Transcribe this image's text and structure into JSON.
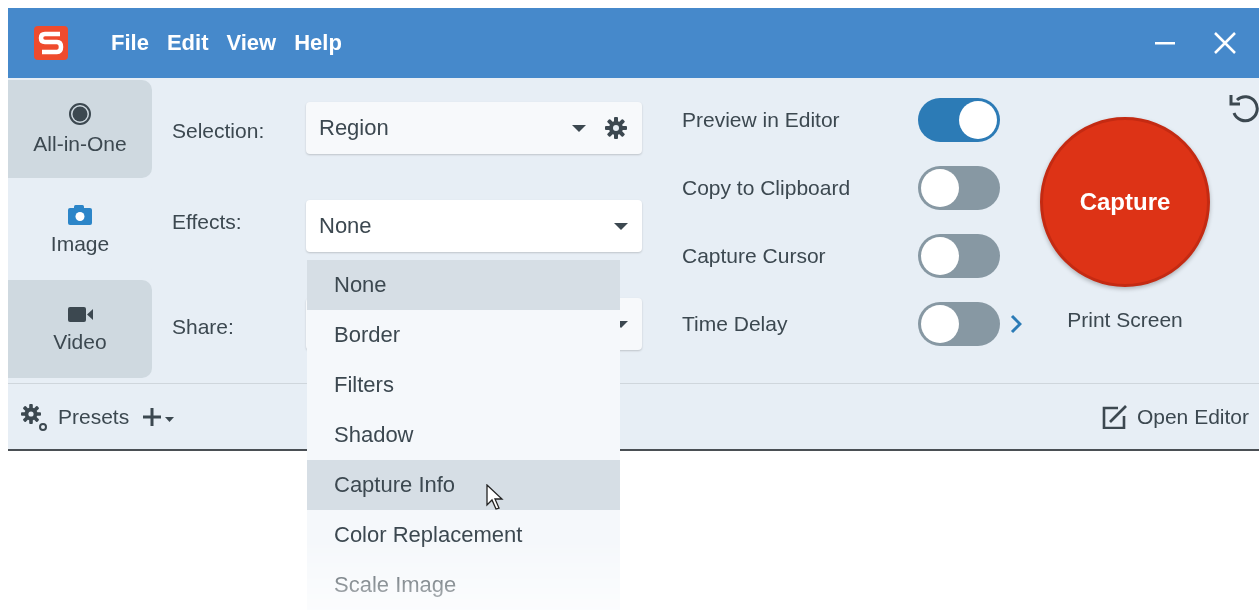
{
  "window": {
    "menu": [
      "File",
      "Edit",
      "View",
      "Help"
    ]
  },
  "tabs": [
    {
      "label": "All-in-One",
      "kind": "record",
      "selected": false
    },
    {
      "label": "Image",
      "kind": "camera",
      "selected": true
    },
    {
      "label": "Video",
      "kind": "video",
      "selected": false
    }
  ],
  "settings": [
    {
      "label": "Selection:",
      "value": "Region",
      "kind": "gear"
    },
    {
      "label": "Effects:",
      "value": "None",
      "kind": "plain"
    },
    {
      "label": "Share:",
      "kind": "plain"
    }
  ],
  "options": [
    {
      "label": "Preview in Editor",
      "kind": "toggle",
      "on": true
    },
    {
      "label": "Copy to Clipboard",
      "kind": "toggle",
      "on": false
    },
    {
      "label": "Capture Cursor",
      "kind": "toggle",
      "on": false
    },
    {
      "label": "Time Delay",
      "kind": "toggle-more",
      "on": false
    }
  ],
  "capture": {
    "button": "Capture",
    "shortcut": "Print Screen"
  },
  "footer": {
    "presets": "Presets",
    "open_editor": "Open Editor"
  },
  "effects_menu": {
    "items": [
      {
        "label": "None",
        "highlighted": true
      },
      {
        "label": "Border",
        "highlighted": false
      },
      {
        "label": "Filters",
        "highlighted": false
      },
      {
        "label": "Shadow",
        "highlighted": false
      },
      {
        "label": "Capture Info",
        "highlighted": true
      },
      {
        "label": "Color Replacement",
        "highlighted": false
      },
      {
        "label": "Scale Image",
        "highlighted": false
      }
    ]
  }
}
